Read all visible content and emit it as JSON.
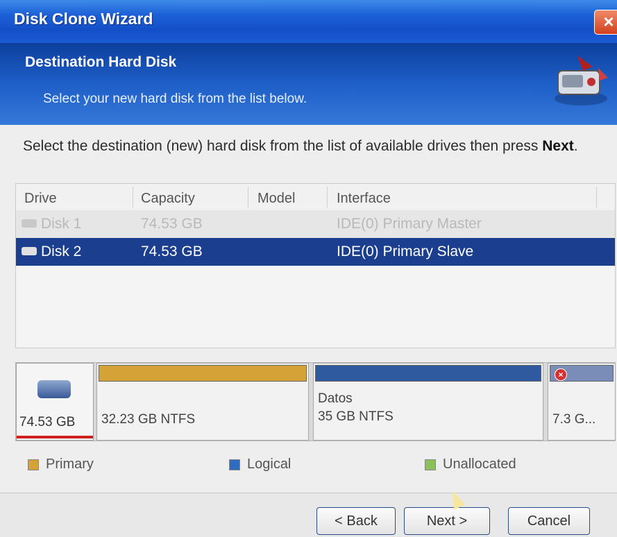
{
  "window": {
    "title": "Disk Clone Wizard",
    "close_glyph": "×"
  },
  "banner": {
    "heading": "Destination Hard Disk",
    "subtitle": "Select your new hard disk from the list below.",
    "art_icon": "disk-clone-art-icon"
  },
  "instructions": {
    "text_before": "Select the destination (new) hard disk from the list of available drives then press ",
    "next_word": "Next",
    "text_after": "."
  },
  "drive_list": {
    "columns": [
      "Drive",
      "Capacity",
      "Model",
      "Interface"
    ],
    "rows": [
      {
        "drive": "Disk 1",
        "capacity": "74.53 GB",
        "model": "",
        "interface": "IDE(0) Primary Master",
        "state": "disabled"
      },
      {
        "drive": "Disk 2",
        "capacity": "74.53 GB",
        "model": "",
        "interface": "IDE(0) Primary Slave",
        "state": "selected"
      }
    ]
  },
  "partition_map": {
    "drive_size": "74.53 GB",
    "partitions": [
      {
        "name": "",
        "size": "32.23 GB NTFS",
        "kind": "Primary"
      },
      {
        "name": "Datos",
        "size": "35 GB NTFS",
        "kind": "Logical"
      },
      {
        "name": "",
        "size": "7.3 G...",
        "kind": "Logical"
      }
    ]
  },
  "legend": {
    "primary": "Primary",
    "logical": "Logical",
    "unallocated": "Unallocated"
  },
  "colors": {
    "primary": "#d4a236",
    "logical": "#2f6cc0",
    "unallocated": "#8cc05a",
    "selection": "#1b3f8e"
  },
  "buttons": {
    "back": "< Back",
    "next": "Next >",
    "cancel": "Cancel"
  }
}
